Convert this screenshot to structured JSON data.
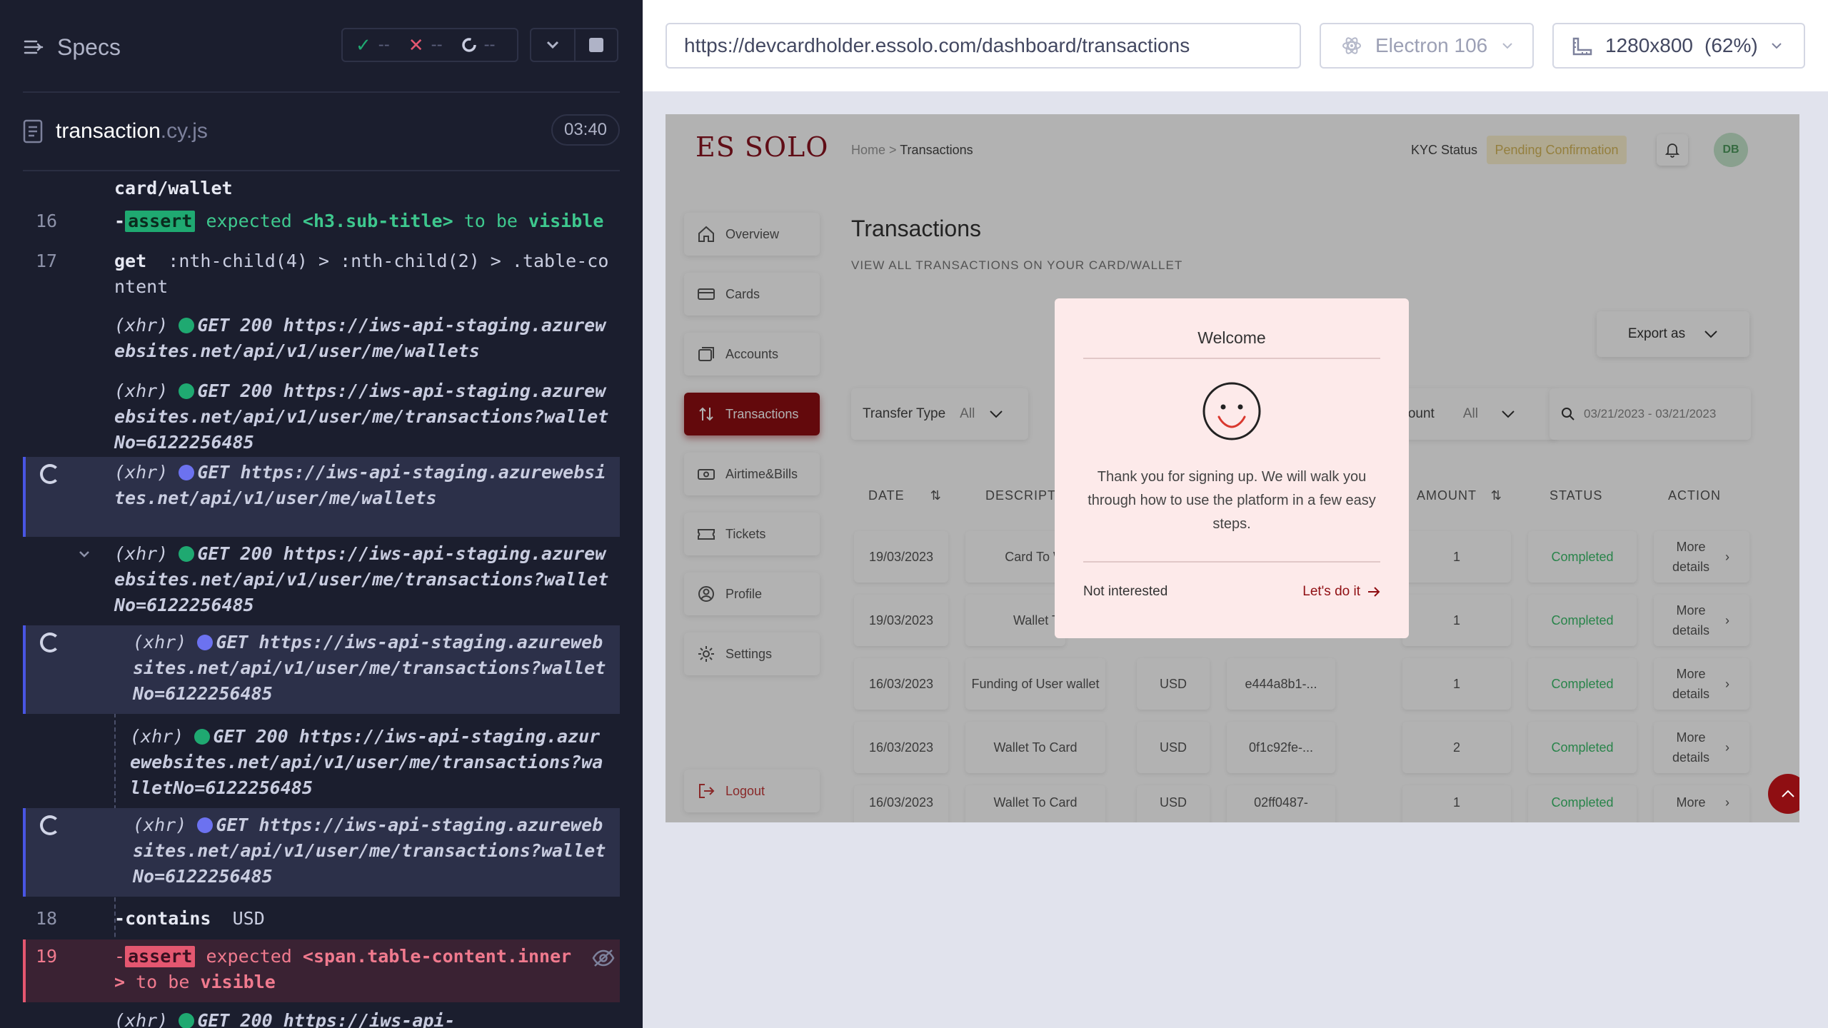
{
  "runner": {
    "panel_title": "Specs",
    "stats": {
      "passed": "--",
      "failed": "--",
      "pending": "--"
    },
    "file": {
      "name": "transaction",
      "ext": ".cy.js",
      "duration": "03:40"
    },
    "commands": {
      "c0_text": "card/wallet",
      "c16_num": "16",
      "c16_dash": "-",
      "c16_kw": "assert",
      "c16_a": "expected",
      "c16_b": "<h3.sub-title>",
      "c16_c": "to be",
      "c16_d": "visible",
      "c17_num": "17",
      "c17_kw": "get",
      "c17_sel": ":nth-child(4) > :nth-child(2) > .table-content",
      "x1_tag": "(xhr)",
      "x1_req": "GET 200 https://iws-api-staging.azurewebsites.net/api/v1/user/me/wallets",
      "x2_tag": "(xhr)",
      "x2_req": "GET 200 https://iws-api-staging.azurewebsites.net/api/v1/user/me/transactions?walletNo=6122256485",
      "x3_tag": "(xhr)",
      "x3_req": "GET https://iws-api-staging.azurewebsites.net/api/v1/user/me/wallets",
      "x4_tag": "(xhr)",
      "x4_req": "GET 200 https://iws-api-staging.azurewebsites.net/api/v1/user/me/transactions?walletNo=6122256485",
      "x5_tag": "(xhr)",
      "x5_req": "GET https://iws-api-staging.azurewebsites.net/api/v1/user/me/transactions?walletNo=6122256485",
      "x6_tag": "(xhr)",
      "x6_req": "GET 200 https://iws-api-staging.azurewebsites.net/api/v1/user/me/transactions?walletNo=6122256485",
      "x7_tag": "(xhr)",
      "x7_req": "GET https://iws-api-staging.azurewebsites.net/api/v1/user/me/transactions?walletNo=6122256485",
      "c18_num": "18",
      "c18_dash": "-",
      "c18_kw": "contains",
      "c18_val": "USD",
      "c19_num": "19",
      "c19_dash": "-",
      "c19_kw": "assert",
      "c19_a": "expected",
      "c19_b": "<span.table-content.inner>",
      "c19_c": "to be",
      "c19_d": "visible",
      "x8_tag": "(xhr)",
      "x8_req": "GET 200 https://iws-api-"
    }
  },
  "browser": {
    "url": "https://devcardholder.essolo.com/dashboard/transactions",
    "engine": "Electron 106",
    "viewport": "1280x800",
    "zoom": "(62%)"
  },
  "app": {
    "logo": "ES SOLO",
    "breadcrumb_home": "Home",
    "breadcrumb_sep": ">",
    "breadcrumb_current": "Transactions",
    "kyc_label": "KYC Status",
    "kyc_value": "Pending Confirmation",
    "avatar": "DB",
    "sidebar": [
      "Overview",
      "Cards",
      "Accounts",
      "Transactions",
      "Airtime&Bills",
      "Tickets",
      "Profile",
      "Settings"
    ],
    "logout": "Logout",
    "page_title": "Transactions",
    "page_subtitle": "VIEW ALL TRANSACTIONS ON YOUR CARD/WALLET",
    "export_label": "Export as",
    "filter_transfer_label": "Transfer Type",
    "filter_transfer_value": "All",
    "filter_amount_label": "mount",
    "filter_amount_value": "All",
    "filter_date": "03/21/2023 - 03/21/2023",
    "columns": {
      "date": "DATE",
      "description": "DESCRIPTI",
      "amount": "AMOUNT",
      "status": "STATUS",
      "action": "ACTION"
    },
    "rows": [
      {
        "date": "19/03/2023",
        "desc": "Card To W",
        "currency": "",
        "ref": "",
        "amount": "1",
        "status": "Completed",
        "action": "More details"
      },
      {
        "date": "19/03/2023",
        "desc": "Wallet To",
        "currency": "",
        "ref": "",
        "amount": "1",
        "status": "Completed",
        "action": "More details"
      },
      {
        "date": "16/03/2023",
        "desc": "Funding of User wallet",
        "currency": "USD",
        "ref": "e444a8b1-...",
        "amount": "1",
        "status": "Completed",
        "action": "More details"
      },
      {
        "date": "16/03/2023",
        "desc": "Wallet To Card",
        "currency": "USD",
        "ref": "0f1c92fe-...",
        "amount": "2",
        "status": "Completed",
        "action": "More details"
      },
      {
        "date": "16/03/2023",
        "desc": "Wallet To Card",
        "currency": "USD",
        "ref": "02ff0487-",
        "amount": "1",
        "status": "Completed",
        "action": "More"
      }
    ],
    "modal": {
      "title": "Welcome",
      "body": "Thank you for signing up. We will walk you through how to use the platform in a few easy steps.",
      "dismiss": "Not interested",
      "confirm": "Let's do it"
    }
  },
  "colors": {
    "brand": "#8f0e12",
    "pass": "#1fa971",
    "fail": "#e45770",
    "pending_dot": "#6c72f0"
  }
}
